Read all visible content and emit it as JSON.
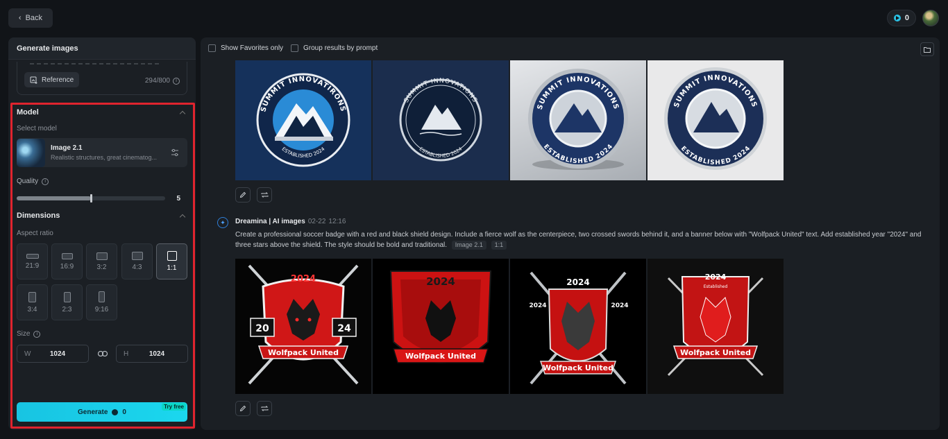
{
  "header": {
    "back_label": "Back",
    "credits": "0"
  },
  "left_panel": {
    "title": "Generate images",
    "reference_label": "Reference",
    "char_count": "294/800",
    "model_section": {
      "title": "Model",
      "select_label": "Select model",
      "model_name": "Image 2.1",
      "model_desc": "Realistic structures, great cinematog..."
    },
    "quality": {
      "label": "Quality",
      "value": "5",
      "fraction": 0.5
    },
    "dimensions": {
      "title": "Dimensions",
      "aspect_label": "Aspect ratio",
      "ratios": [
        "21:9",
        "16:9",
        "3:2",
        "4:3",
        "1:1",
        "3:4",
        "2:3",
        "9:16"
      ],
      "selected": "1:1",
      "size_label": "Size",
      "width_label": "W",
      "width": "1024",
      "height_label": "H",
      "height": "1024"
    },
    "generate": {
      "label": "Generate",
      "cost": "0",
      "badge": "Try free"
    }
  },
  "main": {
    "filters": {
      "favorites": "Show Favorites only",
      "group": "Group results by prompt"
    },
    "batch2": {
      "author": "Dreamina | AI images",
      "date": "02-22",
      "time": "12:16",
      "prompt": "Create a professional soccer badge with a red and black shield design. Include a fierce wolf as the centerpiece, two crossed swords behind it, and a banner below with \"Wolfpack United\" text. Add established year \"2024\" and three stars above the shield. The style should be bold and traditional.",
      "tags": [
        "Image 2.1",
        "1:1"
      ]
    },
    "summit_images": [
      {
        "top": "SUMMIT INNOVATIRONS",
        "bottom": "ESTABLISHED 2024"
      },
      {
        "top": "SUMMIT INNOVATIONS",
        "bottom": "ESTABLISHED 2024"
      },
      {
        "top": "SUMMIT INNOVATIONS",
        "bottom": "ESTABLISHED 2024"
      },
      {
        "top": "SUMMIT INNOVATIONS",
        "bottom": "ESTABLISHED 2024"
      }
    ],
    "wolf_images": [
      {
        "year": "2024",
        "left": "20",
        "right": "24",
        "banner": "Wolfpack United"
      },
      {
        "year": "2024",
        "banner": "Wolfpack United"
      },
      {
        "year": "2024",
        "side_left": "2024",
        "side_right": "2024",
        "banner": "Wolfpack United"
      },
      {
        "year": "2024",
        "small": "Established",
        "banner": "Wolfpack United"
      }
    ]
  }
}
